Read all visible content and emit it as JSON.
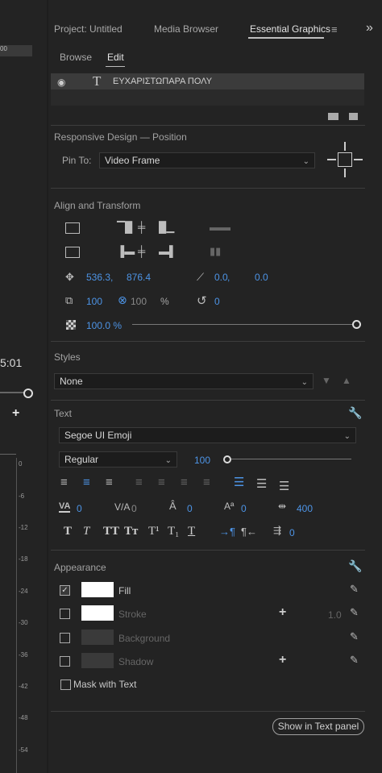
{
  "left_panel": {
    "ruler_value": "00",
    "timecode": "5:01",
    "meter_ticks": [
      "0",
      "-6",
      "-12",
      "-18",
      "-24",
      "-30",
      "-36",
      "-42",
      "-48",
      "-54"
    ]
  },
  "tabs": [
    {
      "label": "Project: Untitled"
    },
    {
      "label": "Media Browser"
    },
    {
      "label": "Essential Graphics",
      "active": true
    }
  ],
  "subtabs": [
    {
      "label": "Browse"
    },
    {
      "label": "Edit",
      "active": true
    }
  ],
  "layer": {
    "name": "ΕΥΧΑΡΙΣΤΩΠΑΡΑ ΠΟΛΥ"
  },
  "responsive": {
    "title": "Responsive Design — Position",
    "pin_label": "Pin To:",
    "pin_value": "Video Frame"
  },
  "align": {
    "title": "Align and Transform",
    "position_x": "536.3",
    "position_y": "876.4",
    "sep": ",",
    "anchor_x": "0.0",
    "anchor_y": "0.0",
    "scale": "100",
    "scale2": "100",
    "scale_unit": "%",
    "rotation": "0",
    "opacity": "100.0 %"
  },
  "styles": {
    "title": "Styles",
    "value": "None"
  },
  "text": {
    "title": "Text",
    "font": "Segoe UI Emoji",
    "style": "Regular",
    "size": "100",
    "kerning": "0",
    "tracking": "0",
    "leading": "0",
    "baseline": "0",
    "tsume": "400",
    "format_buttons": [
      "T",
      "T",
      "TT",
      "Tт",
      "T¹",
      "T₁",
      "T"
    ],
    "indent": "0"
  },
  "appearance": {
    "title": "Appearance",
    "fill_label": "Fill",
    "stroke_label": "Stroke",
    "stroke_width": "1.0",
    "background_label": "Background",
    "shadow_label": "Shadow",
    "mask_label": "Mask with Text",
    "fill_checked": true
  },
  "show_button": "Show in Text panel",
  "colors": {
    "accent": "#4d94e6",
    "panel": "#232323",
    "fill": "#ffffff"
  }
}
